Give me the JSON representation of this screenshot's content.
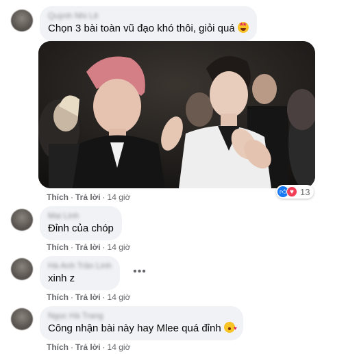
{
  "comments": [
    {
      "author": "Quỳnh Nhi Lê",
      "text": "Chọn 3 bài toàn vũ đạo khó thôi, giỏi quá",
      "emoji": "star-struck-emoji",
      "actions": {
        "like": "Thích",
        "reply": "Trả lời",
        "time": "14 giờ"
      },
      "reactions": {
        "icons": [
          "like-icon",
          "love-icon"
        ],
        "count": "13"
      }
    },
    {
      "author": "Mai Linh",
      "text": "Đỉnh của chóp",
      "actions": {
        "like": "Thích",
        "reply": "Trả lời",
        "time": "14 giờ"
      }
    },
    {
      "author": "Hà Anh Trần Linh",
      "text": "xinh z",
      "actions": {
        "like": "Thích",
        "reply": "Trả lời",
        "time": "14 giờ"
      }
    },
    {
      "author": "Ngọc Hà Trang",
      "text": "Công nhận bài này hay Mlee quá đỉnh",
      "emoji": "kissing-heart-emoji",
      "actions": {
        "like": "Thích",
        "reply": "Trả lời",
        "time": "14 giờ"
      }
    }
  ],
  "colors": {
    "bubble": "#f0f2f5",
    "meta_text": "#65676b",
    "like_blue": "#1877f2",
    "love_red": "#f33e58"
  }
}
